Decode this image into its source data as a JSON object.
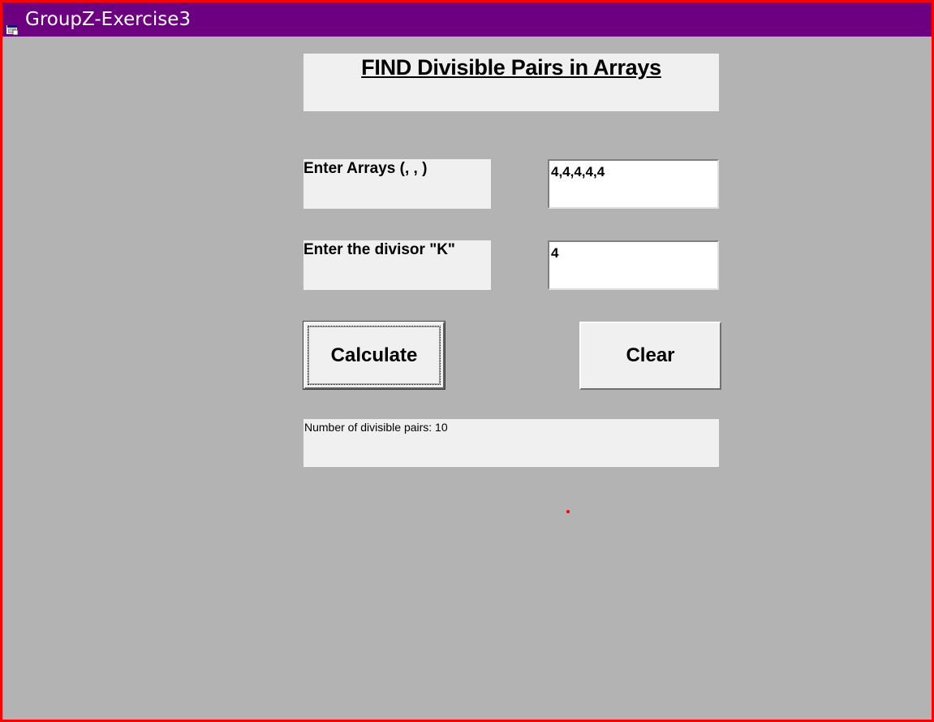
{
  "window": {
    "title": "GroupZ-Exercise3",
    "titlebar_color": "#6c0081",
    "border_color": "#ff0000",
    "background_color": "#b3b3b3"
  },
  "form": {
    "heading": "FIND Divisible Pairs in Arrays",
    "arrays_label": "Enter Arrays (, , )",
    "arrays_value": "4,4,4,4,4",
    "divisor_label": "Enter the divisor \"K\"",
    "divisor_value": "4",
    "calculate_label": "Calculate",
    "clear_label": "Clear",
    "result_text": "Number of divisible pairs: 10"
  },
  "icons": {
    "title_icon": "app-window-icon"
  }
}
